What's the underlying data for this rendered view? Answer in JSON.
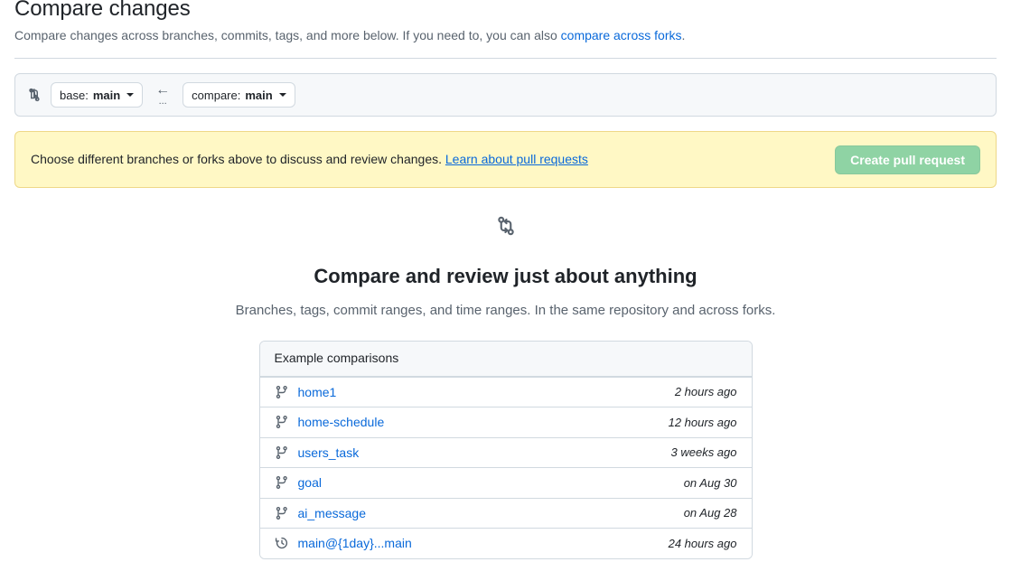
{
  "header": {
    "title": "Compare changes",
    "subtitle_before": "Compare changes across branches, commits, tags, and more below. If you need to, you can also ",
    "subtitle_link": "compare across forks",
    "subtitle_after": "."
  },
  "compare_bar": {
    "icon": "git-compare-icon",
    "base_prefix": "base:",
    "base_branch": "main",
    "separator_arrow": "←",
    "separator_dots": "...",
    "compare_prefix": "compare:",
    "compare_branch": "main"
  },
  "notice": {
    "text": "Choose different branches or forks above to discuss and review changes.",
    "link": "Learn about pull requests",
    "button": "Create pull request",
    "background_color": "#fff8c5",
    "button_color": "#8fd3a4"
  },
  "blankslate": {
    "icon": "git-compare-icon",
    "title": "Compare and review just about anything",
    "subtitle": "Branches, tags, commit ranges, and time ranges. In the same repository and across forks."
  },
  "examples": {
    "heading": "Example comparisons",
    "rows": [
      {
        "icon": "git-branch-icon",
        "label": "home1",
        "time": "2 hours ago"
      },
      {
        "icon": "git-branch-icon",
        "label": "home-schedule",
        "time": "12 hours ago"
      },
      {
        "icon": "git-branch-icon",
        "label": "users_task",
        "time": "3 weeks ago"
      },
      {
        "icon": "git-branch-icon",
        "label": "goal",
        "time": "on Aug 30"
      },
      {
        "icon": "git-branch-icon",
        "label": "ai_message",
        "time": "on Aug 28"
      },
      {
        "icon": "history-icon",
        "label": "main@{1day}...main",
        "time": "24 hours ago"
      }
    ]
  }
}
